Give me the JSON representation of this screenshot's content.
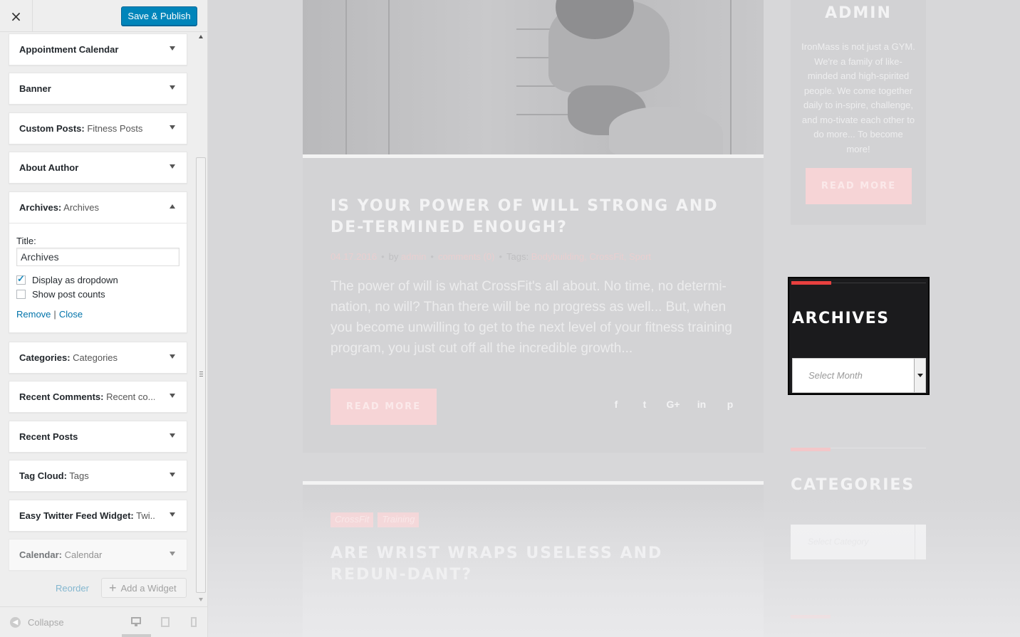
{
  "customizer": {
    "close_icon": "×",
    "publish_label": "Save & Publish",
    "widgets": [
      {
        "title": "Appointment Calendar",
        "subtitle": ""
      },
      {
        "title": "Banner",
        "subtitle": ""
      },
      {
        "title": "Custom Posts:",
        "subtitle": " Fitness Posts"
      },
      {
        "title": "About Author",
        "subtitle": ""
      },
      {
        "title": "Archives:",
        "subtitle": " Archives"
      },
      {
        "title": "Categories:",
        "subtitle": " Categories"
      },
      {
        "title": "Recent Comments:",
        "subtitle": " Recent co..."
      },
      {
        "title": "Recent Posts",
        "subtitle": ""
      },
      {
        "title": "Tag Cloud:",
        "subtitle": " Tags"
      },
      {
        "title": "Easy Twitter Feed Widget:",
        "subtitle": " Twi..."
      },
      {
        "title": "Calendar:",
        "subtitle": " Calendar"
      }
    ],
    "archives_form": {
      "title_label": "Title:",
      "title_value": "Archives",
      "dropdown_label": "Display as dropdown",
      "dropdown_checked": true,
      "counts_label": "Show post counts",
      "counts_checked": false,
      "remove_label": "Remove",
      "separator": "|",
      "close_label": "Close"
    },
    "reorder_label": "Reorder",
    "add_widget_label": "Add a Widget",
    "collapse_label": "Collapse"
  },
  "preview": {
    "post1": {
      "title": "IS YOUR POWER OF WILL STRONG AND DE-TERMINED ENOUGH?",
      "date": "04.17.2016",
      "by": "by",
      "author": "admin",
      "comments": "comments (0)",
      "tags_label": "Tags:",
      "tags": "Bodybuilding, CrossFit, Sport",
      "excerpt": "The power of will is what CrossFit's all about. No time, no determi-nation, no will? Than there will be no progress as well... But, when you become unwilling to get to the next level of your fitness training program, you just cut off all the incredible growth...",
      "read_more": "READ MORE",
      "share_icons": [
        "f",
        "t",
        "G+",
        "in",
        "p"
      ]
    },
    "post2": {
      "tags": [
        "CrossFit",
        "Training"
      ],
      "title": "ARE WRIST WRAPS USELESS AND REDUN-DANT?"
    },
    "about": {
      "title": "ADMIN",
      "text": "IronMass is not just a GYM. We're a family of like-minded and high-spirited people. We come together daily to in-spire, challenge, and mo-tivate each other to do more... To become more!",
      "read_more": "READ MORE"
    },
    "archives_widget": {
      "title": "ARCHIVES",
      "select_value": "Select Month"
    },
    "categories_widget": {
      "title": "CATEGORIES",
      "select_value": "Select Category"
    }
  }
}
